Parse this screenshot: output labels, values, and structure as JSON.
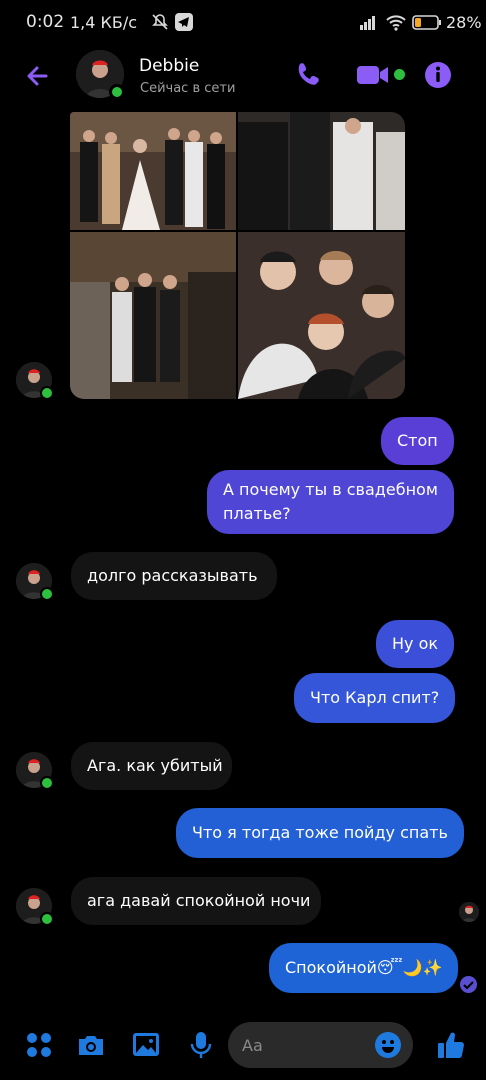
{
  "status_bar": {
    "time": "0:02",
    "speed": "1,4 КБ/с",
    "battery_percent": "28%",
    "battery_level": 0.28
  },
  "header": {
    "contact_name": "Debbie",
    "contact_status": "Сейчас в сети",
    "accent_color": "#8b5cf6"
  },
  "colors": {
    "outgoing_top": "#7b3fe4",
    "outgoing_bottom": "#1f64d6",
    "incoming": "#141414",
    "online": "#2fbf3f",
    "messenger_blue": "#1f7ae0"
  },
  "messages": [
    {
      "side": "out",
      "text": "Стоп"
    },
    {
      "side": "out",
      "text": "А почему ты в свадебном платье?"
    },
    {
      "side": "in",
      "text": "долго  рассказывать"
    },
    {
      "side": "out",
      "text": "Ну ок"
    },
    {
      "side": "out",
      "text": "Что Карл спит?"
    },
    {
      "side": "in",
      "text": "Ага. как убитый"
    },
    {
      "side": "out",
      "text": "Что я тогда тоже пойду спать"
    },
    {
      "side": "in",
      "text": "ага давай спокойной ночи"
    },
    {
      "side": "out",
      "text": "Спокойной😴🌙✨"
    }
  ],
  "composer": {
    "placeholder": "Aa"
  },
  "icons": {
    "bottom_bar": [
      "apps-icon",
      "camera-icon",
      "gallery-icon",
      "microphone-icon",
      "emoji-icon",
      "thumbs-up-icon"
    ],
    "header": [
      "back-arrow-icon",
      "phone-icon",
      "video-camera-icon",
      "info-icon"
    ]
  }
}
